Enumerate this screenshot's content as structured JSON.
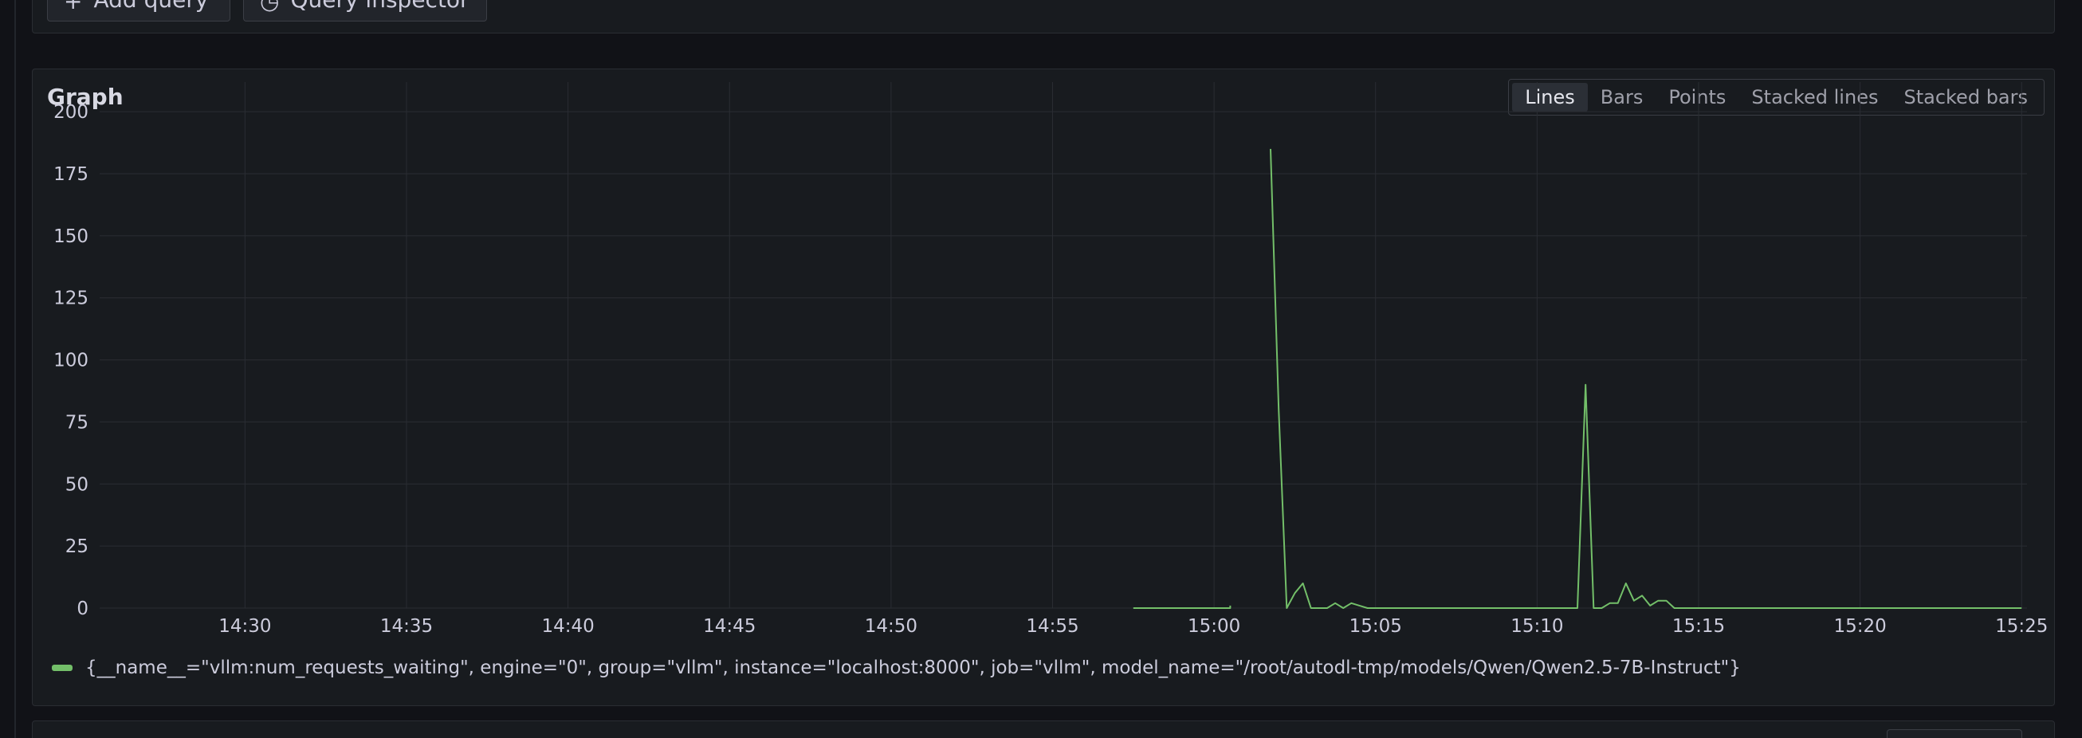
{
  "toolbar": {
    "add_query_icon": "+",
    "add_query_label": "Add query",
    "query_inspector_icon": "◷",
    "query_inspector_label": "Query inspector"
  },
  "graph_panel": {
    "title": "Graph",
    "modes": [
      {
        "label": "Lines",
        "active": true
      },
      {
        "label": "Bars",
        "active": false
      },
      {
        "label": "Points",
        "active": false
      },
      {
        "label": "Stacked lines",
        "active": false
      },
      {
        "label": "Stacked bars",
        "active": false
      }
    ]
  },
  "colors": {
    "series": "#73bf69",
    "grid": "#2a2d33",
    "panel": "#181b1f"
  },
  "chart_data": {
    "type": "line",
    "title": "",
    "xlabel": "",
    "ylabel": "",
    "x_ticks": [
      "14:30",
      "14:35",
      "14:40",
      "14:45",
      "14:50",
      "14:55",
      "15:00",
      "15:05",
      "15:10",
      "15:15",
      "15:20",
      "15:25"
    ],
    "y_ticks": [
      0,
      25,
      50,
      75,
      100,
      125,
      150,
      175,
      200
    ],
    "xlim": [
      "14:25:30",
      "15:25:10"
    ],
    "ylim": [
      0,
      210
    ],
    "grid": true,
    "legend_position": "bottom-left",
    "series": [
      {
        "name": "{__name__=\"vllm:num_requests_waiting\", engine=\"0\", group=\"vllm\", instance=\"localhost:8000\", job=\"vllm\", model_name=\"/root/autodl-tmp/models/Qwen/Qwen2.5-7B-Instruct\"}",
        "segments": [
          [
            [
              "14:57:30",
              0
            ],
            [
              "15:00:30",
              0
            ],
            [
              "15:00:30",
              1
            ]
          ],
          [
            [
              "15:01:45",
              185
            ],
            [
              "15:02:00",
              80
            ],
            [
              "15:02:15",
              0
            ],
            [
              "15:02:30",
              6
            ],
            [
              "15:02:45",
              10
            ],
            [
              "15:03:00",
              0
            ],
            [
              "15:03:30",
              0
            ],
            [
              "15:03:45",
              2
            ],
            [
              "15:04:00",
              0
            ],
            [
              "15:04:15",
              2
            ],
            [
              "15:04:30",
              1
            ],
            [
              "15:04:45",
              0
            ],
            [
              "15:11:15",
              0
            ],
            [
              "15:11:30",
              90
            ],
            [
              "15:11:45",
              0
            ],
            [
              "15:12:00",
              0
            ],
            [
              "15:12:15",
              2
            ],
            [
              "15:12:30",
              2
            ],
            [
              "15:12:45",
              10
            ],
            [
              "15:13:00",
              3
            ],
            [
              "15:13:15",
              5
            ],
            [
              "15:13:30",
              1
            ],
            [
              "15:13:45",
              3
            ],
            [
              "15:14:00",
              3
            ],
            [
              "15:14:15",
              0
            ],
            [
              "15:25:00",
              0
            ]
          ]
        ]
      }
    ]
  }
}
